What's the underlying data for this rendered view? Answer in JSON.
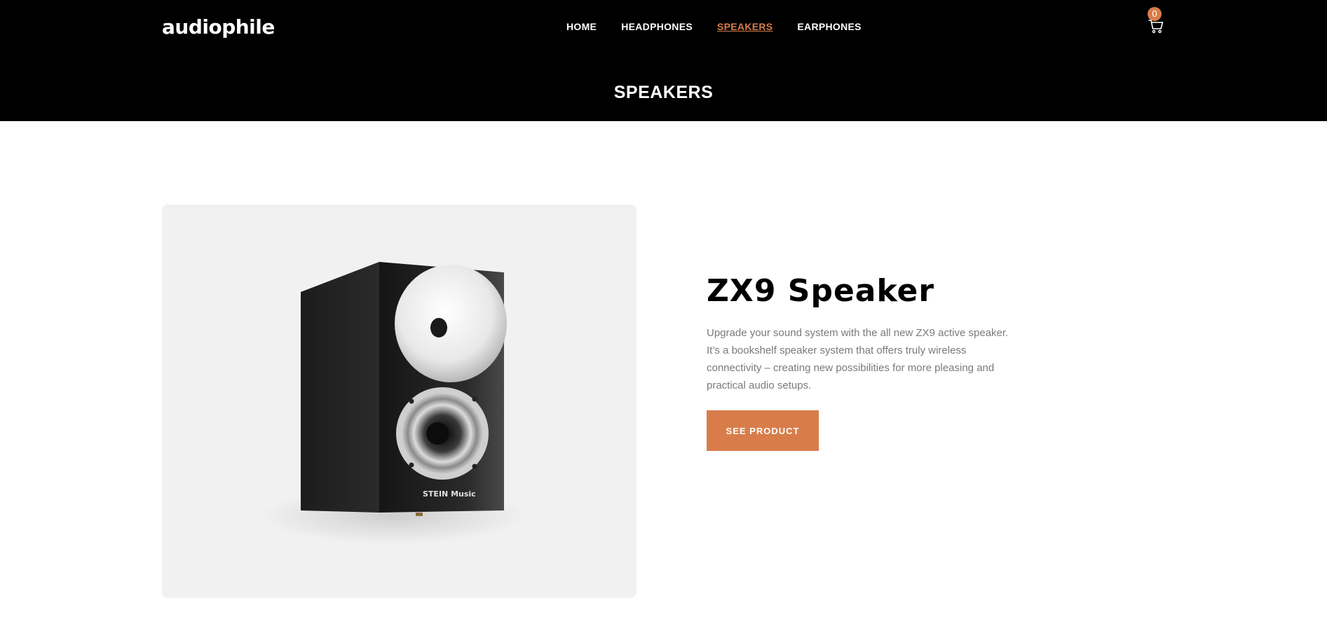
{
  "header": {
    "logo": "audiophile",
    "nav": [
      {
        "label": "HOME"
      },
      {
        "label": "HEADPHONES"
      },
      {
        "label": "SPEAKERS"
      },
      {
        "label": "EARPHONES"
      }
    ],
    "active_nav": "SPEAKERS",
    "cart_count": "0",
    "cart_icon": "cart-icon"
  },
  "category": {
    "title": "SPEAKERS"
  },
  "product": {
    "name": "ZX9 Speaker",
    "description": "Upgrade your sound system with the all new ZX9 active speaker. It’s a bookshelf speaker system that offers truly wireless connectivity – creating new possibilities for more pleasing and practical audio setups.",
    "button_label": "SEE PRODUCT",
    "image_brand": "STEIN Music"
  },
  "colors": {
    "accent": "#d87d4a",
    "header_bg": "#000000",
    "image_bg": "#f1f1f1"
  }
}
